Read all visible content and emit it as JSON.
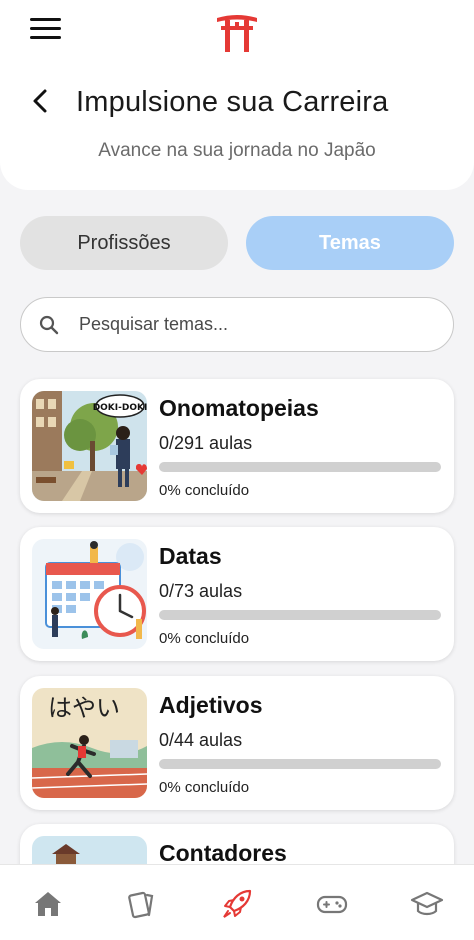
{
  "header": {
    "title": "Impulsione sua Carreira",
    "subtitle": "Avance na sua jornada no Japão"
  },
  "tabs": [
    {
      "label": "Profissões",
      "active": false
    },
    {
      "label": "Temas",
      "active": true
    }
  ],
  "search": {
    "placeholder": "Pesquisar temas...",
    "value": ""
  },
  "topics": [
    {
      "title": "Onomatopeias",
      "lessons": "0/291 aulas",
      "progress_text": "0% concluído",
      "progress": 0,
      "thumb_text": "DOKI-DOKI"
    },
    {
      "title": "Datas",
      "lessons": "0/73 aulas",
      "progress_text": "0% concluído",
      "progress": 0
    },
    {
      "title": "Adjetivos",
      "lessons": "0/44 aulas",
      "progress_text": "0% concluído",
      "progress": 0,
      "thumb_text": "はやい"
    },
    {
      "title": "Contadores",
      "lessons": "",
      "progress_text": "",
      "progress": 0
    }
  ],
  "nav": {
    "items": [
      "home-icon",
      "cards-icon",
      "rocket-icon",
      "gamepad-icon",
      "graduation-cap-icon"
    ],
    "active": "rocket-icon"
  },
  "colors": {
    "accent": "#a9cff7",
    "brand_red": "#e53935",
    "inactive_tab": "#e2e2e2",
    "progress_track": "#d0d0d0"
  }
}
